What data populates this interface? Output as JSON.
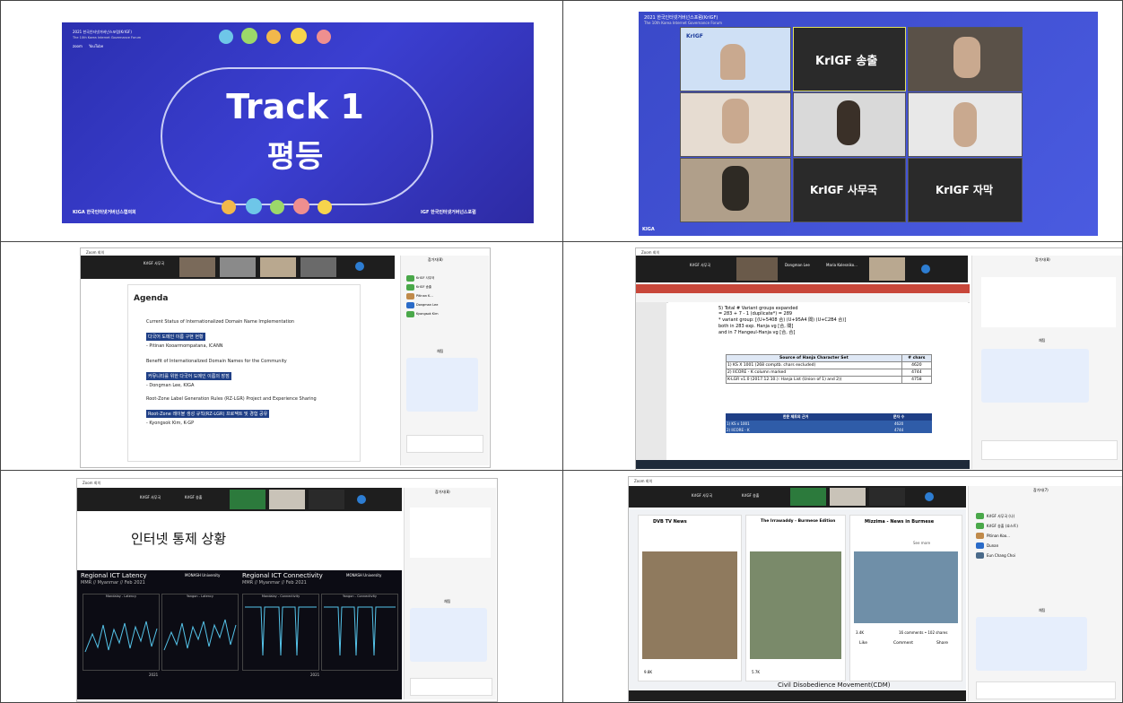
{
  "cell1": {
    "forum_line1": "2021 한국인터넷거버넌스포럼(KrIGF)",
    "forum_line2": "The 10th Korea Internet Governance Forum",
    "streams": [
      "zoom",
      "YouTube"
    ],
    "title": "Track 1",
    "subtitle": "평등",
    "kiga": "KIGA 한국인터넷거버넌스협의회",
    "igf": "IGF 한국인터넷거버넌스포럼"
  },
  "cell2": {
    "forum_line1": "2021 한국인터넷거버넌스포럼(KrIGF)",
    "forum_line2": "The 10th Korea Internet Governance Forum",
    "tiles": [
      "KrIGF",
      "KrIGF 송출",
      "",
      "",
      "",
      "",
      "",
      "KrIGF 사무국",
      "KrIGF 자막"
    ],
    "kiga": "KIGA"
  },
  "cell3": {
    "app_title": "Zoom 회의",
    "agenda_title": "Agenda",
    "bullets": [
      {
        "en": "Current Status of Internationalized Domain Name Implementation",
        "ko": "다국어 도메인 이름 구현 현황",
        "who": "- Pitinan Kooarmompatana, ICANN"
      },
      {
        "en": "Benefit of Internationalized Domain Names for the Community",
        "ko": "커뮤니티를 위한 다국어 도메인 이름의 장점",
        "who": "- Dongman Lee, KIGA"
      },
      {
        "en": "Root-Zone Label Generation Rules (RZ-LGR) Project and Experience Sharing",
        "ko": "Root-Zone 레이블 생성 규칙(RZ-LGR) 프로젝트 및 경험 공유",
        "who": "- Kyongsok Kim, K-GP"
      }
    ],
    "speakers": [
      "KrIGF 사무국",
      "KrIGF 송출",
      "Pitinan K...",
      "Dongman Lee",
      "Kyongsok Kim"
    ],
    "participants_title": "참가자(8)",
    "chat_title": "채팅"
  },
  "cell4": {
    "app_title": "Zoom 회의",
    "speakers": [
      "KrIGF 사무국",
      "Dongman Lee",
      "Maria Kolesniko..."
    ],
    "text_lines": [
      "5) Total # Variant groups expanded",
      "= 283 + 7 - 1 (duplicate*) = 289",
      "* variant group: [(U+5408 合) (U+95A4 閤) (U+C2B4 合)]",
      "both in 283 exp. Hanja vg [合, 閤]",
      "and in 7 Hangeul-Hanja vg [合, 合]"
    ],
    "table_headers": [
      "Source of Hanja Character Set",
      "# chars"
    ],
    "table_rows": [
      [
        "1) KS X 1001 (268 comptb. chars excluded)",
        "4620"
      ],
      [
        "2) IICORE - K column marked",
        "4744"
      ],
      [
        "K-LGR v1.0 (2017.12.10.): Hanja List (Union of 1) and 2))",
        "4758"
      ]
    ],
    "table2_headers": [
      "한문 제트의 근거",
      "문자 수"
    ],
    "table2_rows": [
      [
        "1) KS x 1001",
        "4620"
      ],
      [
        "2) IICORE - K",
        "4744"
      ]
    ],
    "participants_title": "참가자(8)",
    "chat_title": "채팅"
  },
  "cell5": {
    "app_title": "Zoom 회의",
    "speakers": [
      "KrIGF 사무국",
      "KrIGF 송출"
    ],
    "slide_title": "인터넷 통제 상황",
    "chart1_title": "Regional ICT Latency",
    "chart1_sub": "MMR // Myanmar // Feb 2021",
    "chart1_panels": [
      "Mandalay - Latency",
      "Yangon - Latency"
    ],
    "chart2_title": "Regional ICT Connectivity",
    "chart2_sub": "MMR // Myanmar // Feb 2021",
    "chart2_panels": [
      "Mandalay - Connectivity",
      "Yangon - Connectivity"
    ],
    "monash": "MONASH University",
    "x_label": "2021",
    "participants_title": "참가자(8)",
    "chat_title": "채팅"
  },
  "cell6": {
    "app_title": "Zoom 회의",
    "speakers": [
      "KrIGF 사무국",
      "KrIGF 송출"
    ],
    "posts": [
      {
        "source": "DVB TV News",
        "comments": "",
        "reactions": "9.8K"
      },
      {
        "source": "The Irrawaddy - Burmese Edition",
        "comments": "",
        "reactions": "5.7K"
      },
      {
        "source": "Mizzima - News in Burmese",
        "comments": "16 comments • 102 shares",
        "reactions": "3.4K",
        "see_more": "See more"
      }
    ],
    "actions": [
      "Like",
      "Comment",
      "Share"
    ],
    "caption": "Civil Disobedience Movement(CDM)",
    "participants": [
      "KrIGF 사무국 (나)",
      "KrIGF 송출 (호스트)",
      "Pitinan Koo...",
      "Dunan",
      "Eun Chang Choi"
    ],
    "participants_title": "참가자(7)",
    "chat_title": "채팅"
  }
}
